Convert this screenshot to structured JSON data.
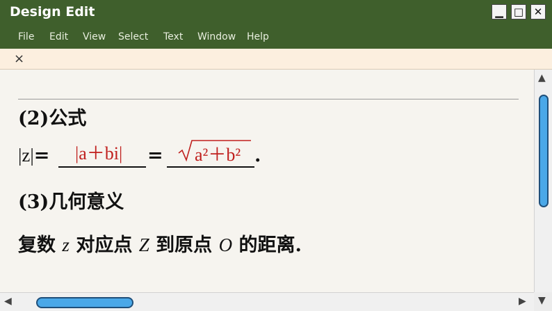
{
  "window": {
    "title": "Design Edit",
    "minimize_glyph": "▁",
    "maximize_glyph": "□",
    "close_glyph": "✕"
  },
  "menu": [
    "File",
    "Edit",
    "View",
    "Select",
    "Text",
    "Window",
    "Help"
  ],
  "doc_tab": {
    "close_glyph": "×"
  },
  "content": {
    "formula_heading": "(2)公式",
    "formula_lhs": "|z|",
    "equals1": "=",
    "answer1": "|a＋bi|",
    "equals2": "=",
    "answer2_radicand": "a²＋b²",
    "period": ".",
    "meaning_heading": "(3)几何意义",
    "meaning_text_1": "复数",
    "meaning_var_z": "z",
    "meaning_text_2": "对应点",
    "meaning_var_Z": "Z",
    "meaning_text_3": "到原点",
    "meaning_var_O": "O",
    "meaning_text_4": "的距离."
  },
  "colors": {
    "titlebar": "#3f5f2c",
    "answer": "#c0201e",
    "scroll_thumb": "#4aa8e8"
  }
}
